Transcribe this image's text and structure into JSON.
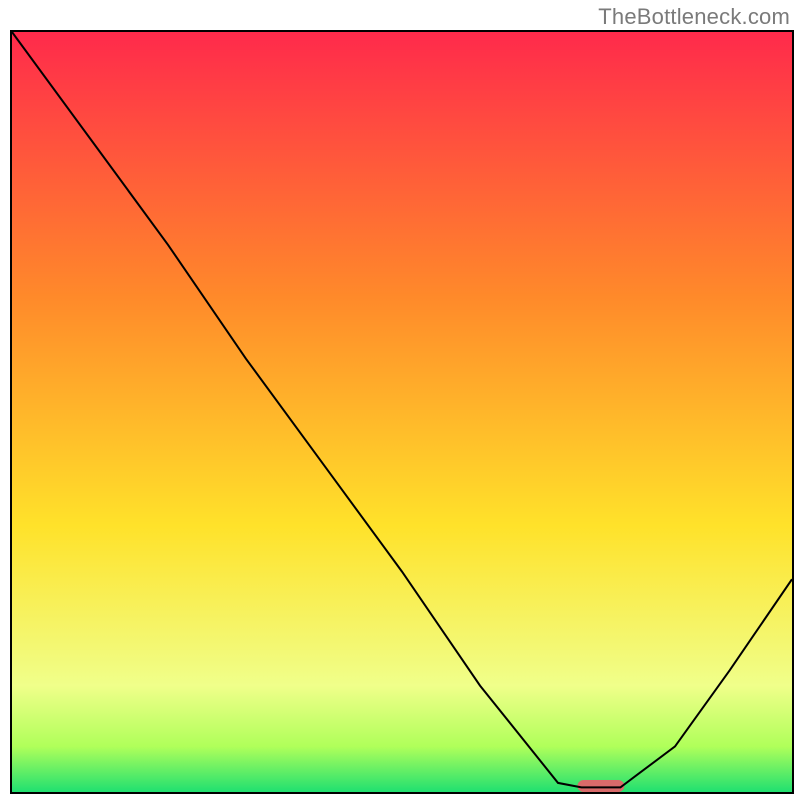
{
  "watermark": "TheBottleneck.com",
  "chart_data": {
    "type": "line",
    "title": "",
    "xlabel": "",
    "ylabel": "",
    "xlim": [
      0,
      100
    ],
    "ylim": [
      0,
      100
    ],
    "grid": false,
    "series": [
      {
        "name": "bottleneck-curve",
        "x": [
          0,
          10,
          20,
          30,
          40,
          50,
          60,
          70,
          73,
          78,
          85,
          92,
          100
        ],
        "values": [
          100,
          86,
          72,
          57,
          43,
          29,
          14,
          1.2,
          0.6,
          0.6,
          6,
          16,
          28
        ],
        "stroke": "#000000",
        "stroke_width": 2
      }
    ],
    "marker": {
      "name": "optimal-zone",
      "x_center": 75.5,
      "width": 6,
      "color": "#d96a6a"
    },
    "background_gradient": {
      "top_color": "#ff2a4b",
      "mid1_color": "#ff8a2a",
      "mid2_color": "#ffe22a",
      "green_pale": "#f0ff8a",
      "green_mid": "#b0ff5a",
      "green_deep": "#20e070"
    }
  }
}
